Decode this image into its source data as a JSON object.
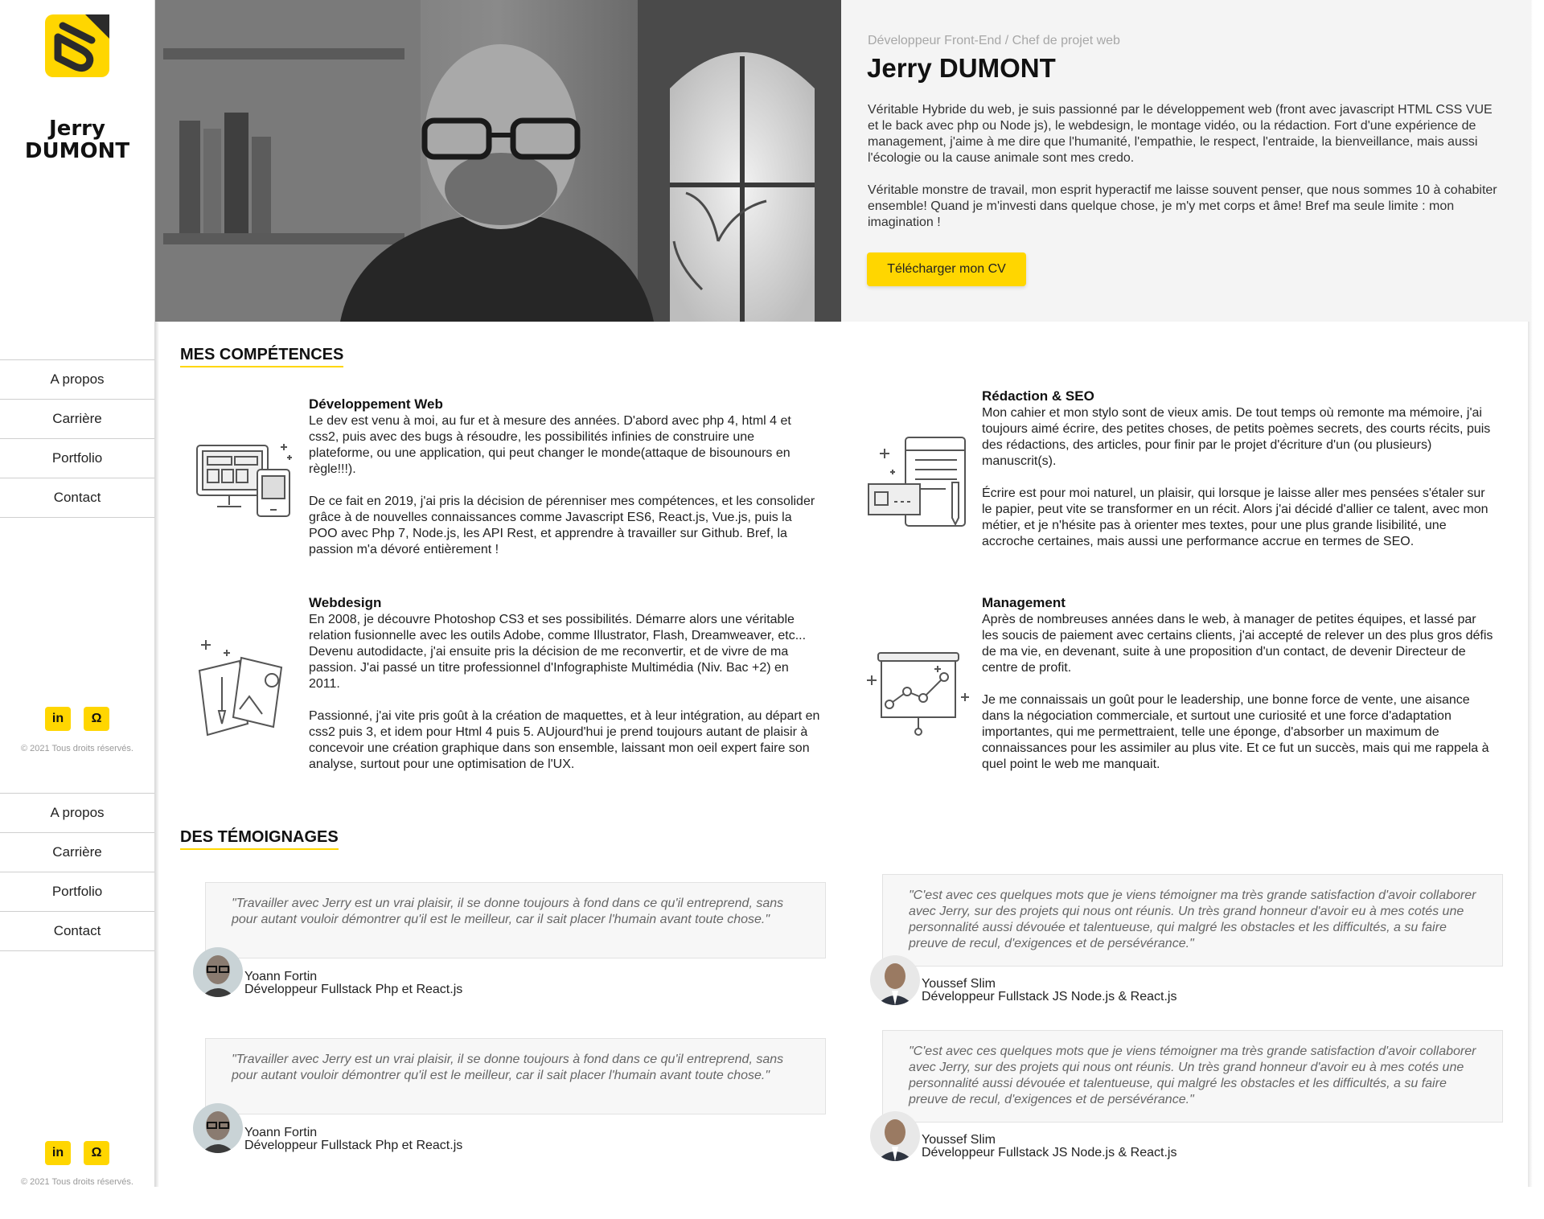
{
  "brand": {
    "first_name": "Jerry",
    "last_name": "DUMONT"
  },
  "nav": [
    "A propos",
    "Carrière",
    "Portfolio",
    "Contact"
  ],
  "socials": {
    "linkedin": "in",
    "github": "Ω"
  },
  "copyright": "© 2021 Tous droits réservés.",
  "hero": {
    "role": "Développeur Front-End / Chef de projet web",
    "name": "Jerry DUMONT",
    "bio": [
      "Véritable Hybride du web, je suis passionné par le développement web (front avec javascript HTML CSS VUE et le back avec php ou Node js), le webdesign, le montage vidéo, ou la rédaction. Fort d'une expérience de management, j'aime à me dire que l'humanité, l'empathie, le respect, l'entraide, la bienveillance, mais aussi l'écologie ou la cause animale sont mes credo.",
      "Véritable monstre de travail, mon esprit hyperactif me laisse souvent penser, que nous sommes 10 à cohabiter ensemble! Quand je m'investi dans quelque chose, je m'y met corps et âme! Bref ma seule limite : mon imagination !"
    ],
    "cv_button": "Télécharger mon CV"
  },
  "skills_title": "MES COMPÉTENCES",
  "skills": [
    {
      "title": "Développement Web",
      "icon": "devices-icon",
      "paragraphs": [
        "Le dev est venu à moi, au fur et à mesure des années. D'abord avec php 4, html 4 et css2, puis avec des bugs à résoudre, les possibilités infinies de construire une plateforme, ou une application, qui peut changer le monde(attaque de bisounours en règle!!!).",
        "De ce fait en 2019, j'ai pris la décision de pérenniser mes compétences, et les consolider grâce à de nouvelles connaissances comme Javascript ES6, React.js, Vue.js, puis la POO avec Php 7, Node.js, les API Rest, et apprendre à travailler sur Github. Bref, la passion m'a dévoré entièrement !"
      ]
    },
    {
      "title": "Rédaction & SEO",
      "icon": "writing-icon",
      "paragraphs": [
        "Mon cahier et mon stylo sont de vieux amis. De tout temps où remonte ma mémoire, j'ai toujours aimé écrire, des petites choses, de petits poèmes secrets, des courts récits, puis des rédactions, des articles, pour finir par le projet d'écriture d'un (ou plusieurs) manuscrit(s).",
        "Écrire est pour moi naturel, un plaisir, qui lorsque je laisse aller mes pensées s'étaler sur le papier, peut vite se transformer en un récit. Alors j'ai décidé d'allier ce talent, avec mon métier, et je n'hésite pas à orienter mes textes, pour une plus grande lisibilité, une accroche certaines, mais aussi une performance accrue en termes de SEO."
      ]
    },
    {
      "title": "Webdesign",
      "icon": "design-icon",
      "paragraphs": [
        "En 2008, je découvre Photoshop CS3 et ses possibilités. Démarre alors une véritable relation fusionnelle avec les outils Adobe, comme Illustrator, Flash, Dreamweaver, etc... Devenu autodidacte, j'ai ensuite pris la décision de me reconvertir, et de vivre de ma passion. J'ai passé un titre professionnel d'Infographiste Multimédia (Niv. Bac +2) en 2011.",
        "Passionné, j'ai vite pris goût à la création de maquettes, et à leur intégration, au départ en css2 puis 3, et idem pour Html 4 puis 5. AUjourd'hui je prend toujours autant de plaisir à concevoir une création graphique dans son ensemble, laissant mon oeil expert faire son analyse, surtout pour une optimisation de l'UX."
      ]
    },
    {
      "title": "Management",
      "icon": "presentation-board-icon",
      "paragraphs": [
        "Après de nombreuses années dans le web, à manager de petites équipes, et lassé par les soucis de paiement avec certains clients, j'ai accepté de relever un des plus gros défis de ma vie, en devenant, suite à une proposition d'un contact, de devenir Directeur de centre de profit.",
        "Je me connaissais un goût pour le leadership, une bonne force de vente, une aisance dans la négociation commerciale, et surtout une curiosité et une force d'adaptation importantes, qui me permettraient, telle une éponge, d'absorber un maximum de connaissances pour les assimiler au plus vite. Et ce fut un succès, mais qui me rappela à quel point le web me manquait."
      ]
    }
  ],
  "testimonials_title": "DES TÉMOIGNAGES",
  "testimonials": [
    {
      "quote": "\"Travailler avec Jerry est un vrai plaisir, il se donne toujours à fond dans ce qu'il entreprend, sans pour autant vouloir démontrer qu'il est le meilleur, car il sait placer l'humain avant toute chose.\"",
      "name": "Yoann Fortin",
      "role": "Développeur Fullstack Php et React.js"
    },
    {
      "quote": "\"C'est avec ces quelques mots que je viens témoigner ma très grande satisfaction d'avoir collaborer avec Jerry, sur des projets qui nous ont réunis. Un très grand honneur d'avoir eu à mes cotés une personnalité aussi dévouée et talentueuse, qui malgré les obstacles et les difficultés, a su faire preuve de recul, d'exigences et de persévérance.\"",
      "name": "Youssef Slim",
      "role": "Développeur Fullstack JS Node.js & React.js"
    },
    {
      "quote": "\"Travailler avec Jerry est un vrai plaisir, il se donne toujours à fond dans ce qu'il entreprend, sans pour autant vouloir démontrer qu'il est le meilleur, car il sait placer l'humain avant toute chose.\"",
      "name": "Yoann Fortin",
      "role": "Développeur Fullstack Php et React.js"
    },
    {
      "quote": "\"C'est avec ces quelques mots que je viens témoigner ma très grande satisfaction d'avoir collaborer avec Jerry, sur des projets qui nous ont réunis. Un très grand honneur d'avoir eu à mes cotés une personnalité aussi dévouée et talentueuse, qui malgré les obstacles et les difficultés, a su faire preuve de recul, d'exigences et de persévérance.\"",
      "name": "Youssef Slim",
      "role": "Développeur Fullstack JS Node.js & React.js"
    }
  ],
  "colors": {
    "accent": "#ffd600",
    "text": "#222222",
    "muted": "#a7a7a7",
    "panel": "#f4f4f4"
  }
}
